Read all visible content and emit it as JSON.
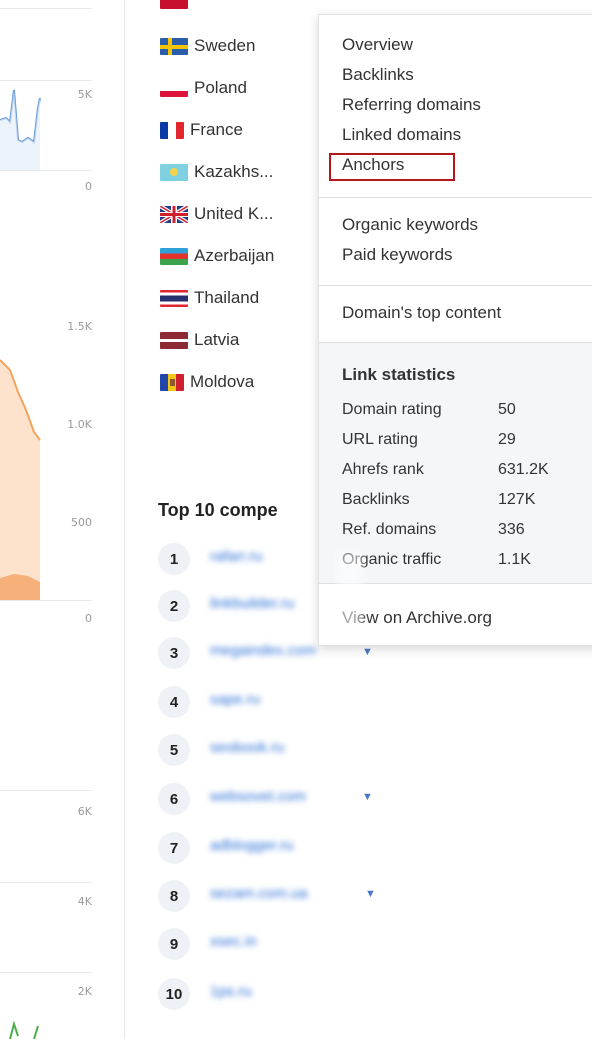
{
  "left_axis": {
    "labels_top": [
      "5K",
      "0"
    ],
    "labels_mid": [
      "1.5K",
      "1.0K",
      "500",
      "0"
    ],
    "labels_bottom": [
      "6K",
      "4K",
      "2K"
    ]
  },
  "countries": [
    {
      "name": "Sweden",
      "flag": "sweden"
    },
    {
      "name": "Poland",
      "flag": "poland"
    },
    {
      "name": "France",
      "flag": "france"
    },
    {
      "name": "Kazakhs...",
      "flag": "kazakhstan"
    },
    {
      "name": "United K...",
      "flag": "uk"
    },
    {
      "name": "Azerbaijan",
      "flag": "azerbaijan"
    },
    {
      "name": "Thailand",
      "flag": "thailand"
    },
    {
      "name": "Latvia",
      "flag": "latvia"
    },
    {
      "name": "Moldova",
      "flag": "moldova"
    }
  ],
  "competitors": {
    "title": "Top 10 compe",
    "items": [
      {
        "rank": "1",
        "domain": "rafarr.ru"
      },
      {
        "rank": "2",
        "domain": "linkbuilder.ru"
      },
      {
        "rank": "3",
        "domain": "megaindex.com"
      },
      {
        "rank": "4",
        "domain": "sape.ru"
      },
      {
        "rank": "5",
        "domain": "seobook.ru"
      },
      {
        "rank": "6",
        "domain": "websovet.com"
      },
      {
        "rank": "7",
        "domain": "adblogger.ru"
      },
      {
        "rank": "8",
        "domain": "sezam.com.ua"
      },
      {
        "rank": "9",
        "domain": "xsec.in"
      },
      {
        "rank": "10",
        "domain": "1ps.ru"
      }
    ]
  },
  "menu": {
    "group1": [
      "Overview",
      "Backlinks",
      "Referring domains",
      "Linked domains",
      "Anchors"
    ],
    "group2": [
      "Organic keywords",
      "Paid keywords"
    ],
    "group3": [
      "Domain's top content"
    ],
    "stats_title": "Link statistics",
    "stats": [
      {
        "label": "Domain rating",
        "value": "50"
      },
      {
        "label": "URL rating",
        "value": "29"
      },
      {
        "label": "Ahrefs rank",
        "value": "631.2K"
      },
      {
        "label": "Backlinks",
        "value": "127K"
      },
      {
        "label": "Ref. domains",
        "value": "336"
      },
      {
        "label": "Organic traffic",
        "value": "1.1K"
      }
    ],
    "archive": "View on Archive.org",
    "highlight_color": "#b2171b"
  }
}
